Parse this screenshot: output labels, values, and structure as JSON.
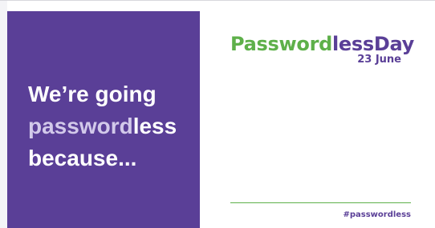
{
  "headline": {
    "line1": "We’re going",
    "line2_light": "password",
    "line2_white": "less",
    "line3": "because..."
  },
  "logo": {
    "part_green": "Password",
    "part_purple": "lessDay",
    "date": "23 June"
  },
  "footer": {
    "hashtag": "#passwordless"
  },
  "colors": {
    "panel_purple": "#5a3f97",
    "accent_green": "#5eb04a",
    "light_lavender": "#d2c9ea"
  }
}
